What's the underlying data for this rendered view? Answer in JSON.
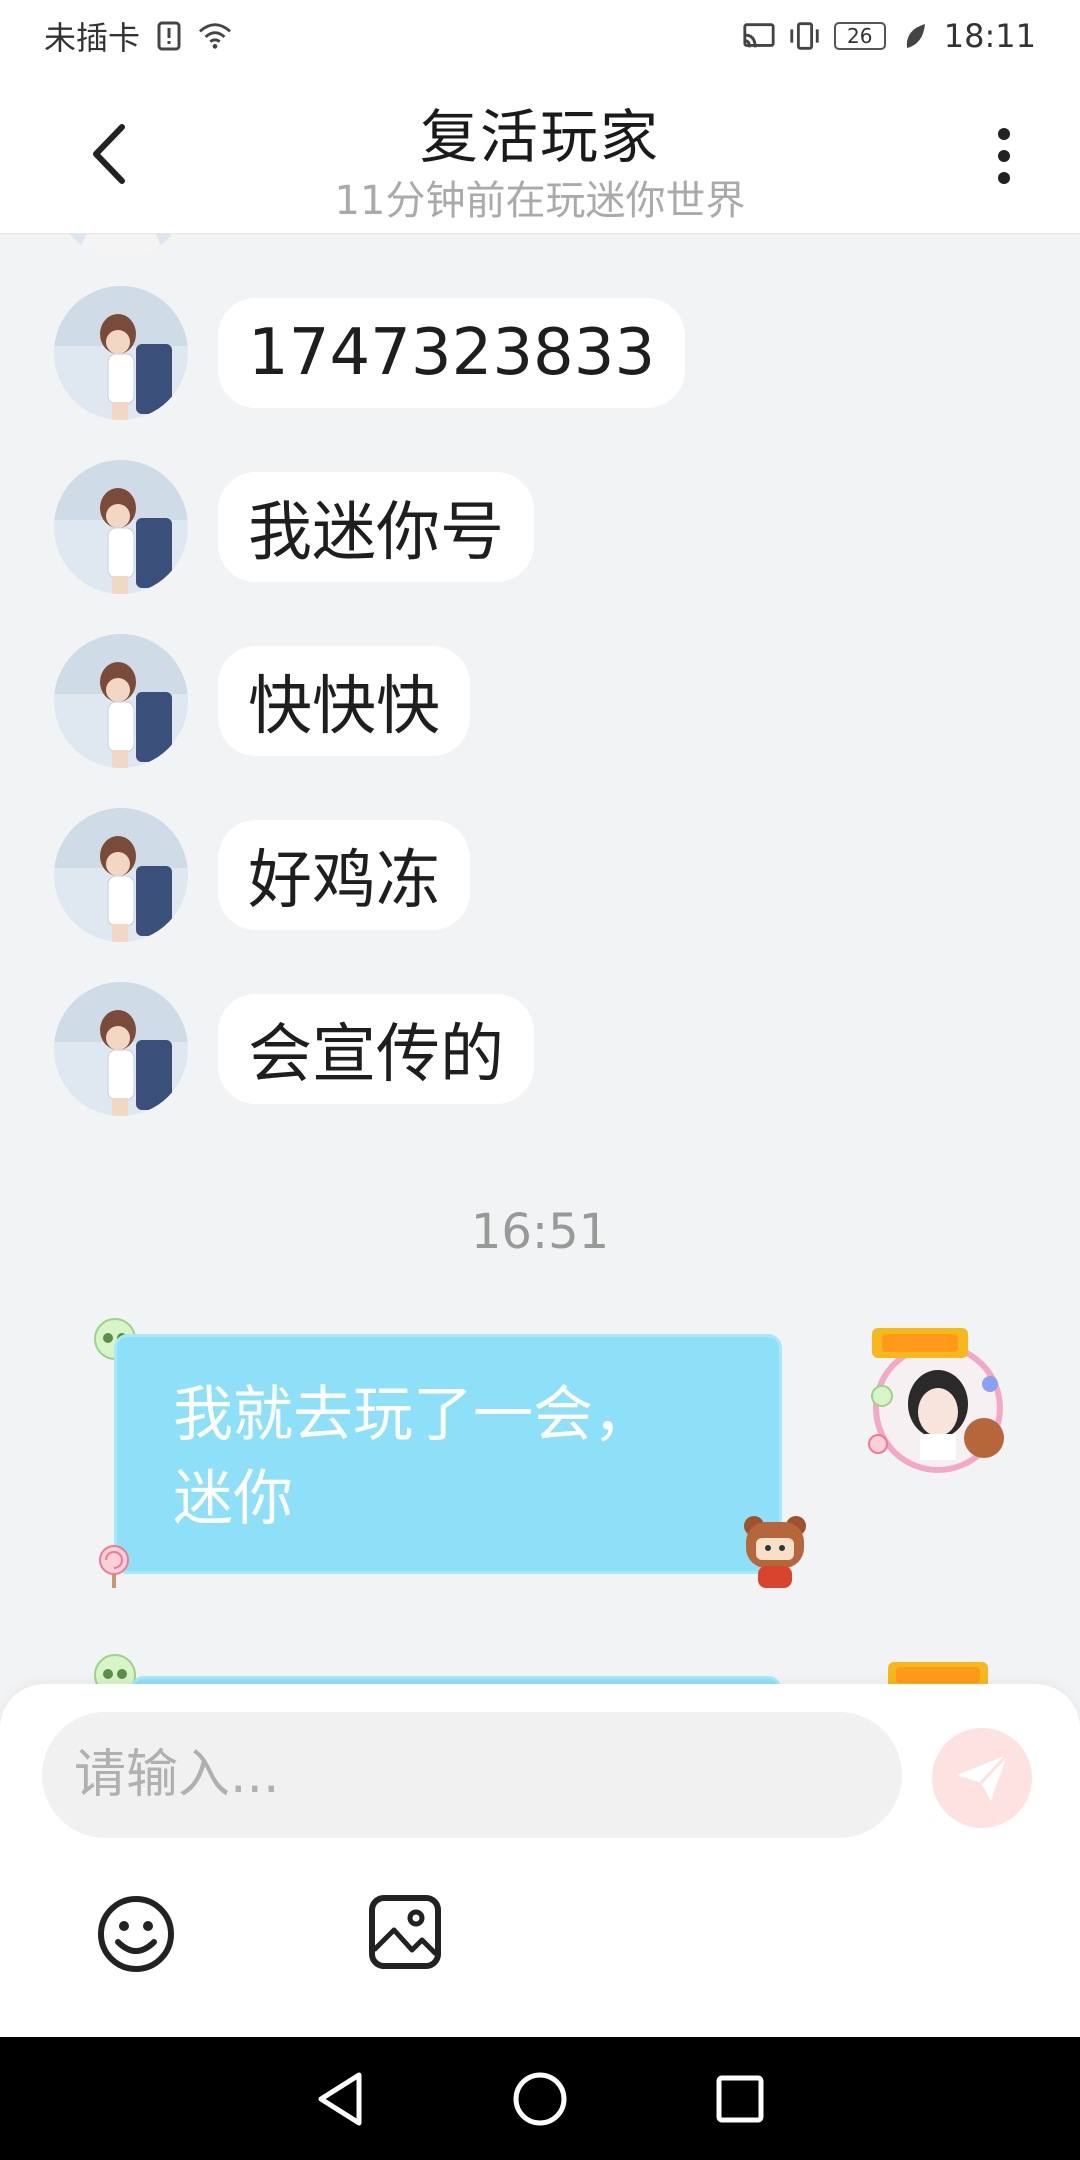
{
  "status_bar": {
    "carrier": "未插卡",
    "battery": "26",
    "time": "18:11"
  },
  "header": {
    "title": "复活玩家",
    "subtitle": "11分钟前在玩迷你世界"
  },
  "messages": [
    {
      "text": "1747323833"
    },
    {
      "text": "我迷你号"
    },
    {
      "text": "快快快"
    },
    {
      "text": "好鸡冻"
    },
    {
      "text": "会宣传的"
    }
  ],
  "timestamp": "16:51",
  "outgoing": {
    "line1": "我就去玩了一会，",
    "line2": "迷你"
  },
  "input": {
    "placeholder": "请输入..."
  },
  "icons": {
    "back": "chevron-left-icon",
    "more": "more-vertical-icon",
    "send": "paper-plane-icon",
    "emoji": "smiley-icon",
    "image": "image-icon"
  },
  "colors": {
    "bubble_out": "#8ee0f8",
    "send_bg": "#fde2e1",
    "chat_bg": "#f2f3f5"
  }
}
